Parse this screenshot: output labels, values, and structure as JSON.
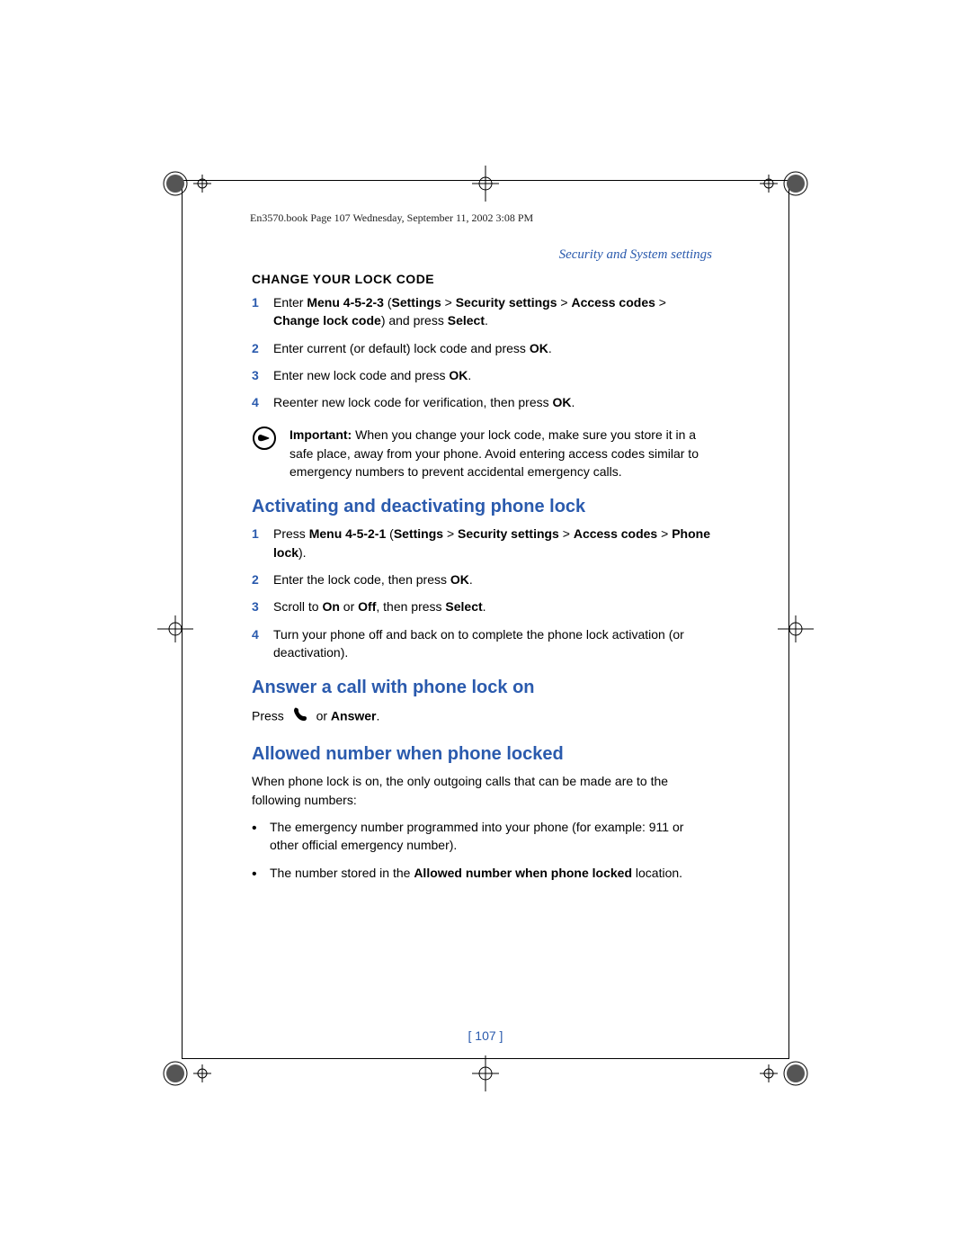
{
  "header_line": "En3570.book  Page 107  Wednesday, September 11, 2002  3:08 PM",
  "running_head": "Security and System settings",
  "section_change": {
    "title": "CHANGE YOUR LOCK CODE",
    "steps": [
      {
        "num": "1",
        "html": "Enter <b>Menu 4-5-2-3</b> (<b>Settings</b> > <b>Security settings</b> > <b>Access codes</b> > <b>Change lock code</b>) and press <b>Select</b>."
      },
      {
        "num": "2",
        "html": "Enter current (or default) lock code and press <b>OK</b>."
      },
      {
        "num": "3",
        "html": "Enter new lock code and press <b>OK</b>."
      },
      {
        "num": "4",
        "html": "Reenter new lock code for verification, then press <b>OK</b>."
      }
    ],
    "note_html": "<b>Important:</b> When you change your lock code, make sure you store it in a safe place, away from your phone. Avoid entering access codes similar to emergency numbers to prevent accidental emergency calls."
  },
  "section_activate": {
    "title": "Activating and deactivating phone lock",
    "steps": [
      {
        "num": "1",
        "html": "Press <b>Menu 4-5-2-1</b> (<b>Settings</b> > <b>Security settings</b> > <b>Access codes</b> > <b>Phone lock</b>)."
      },
      {
        "num": "2",
        "html": "Enter the lock code, then press <b>OK</b>."
      },
      {
        "num": "3",
        "html": "Scroll to <b>On</b> or <b>Off</b>, then press <b>Select</b>."
      },
      {
        "num": "4",
        "html": "Turn your phone off and back on to complete the phone lock activation (or deactivation)."
      }
    ]
  },
  "section_answer": {
    "title": "Answer a call with phone lock on",
    "press_before": "Press",
    "press_after": "or <b>Answer</b>."
  },
  "section_allowed": {
    "title": "Allowed number when phone locked",
    "intro": "When phone lock is on, the only outgoing calls that can be made are to the following numbers:",
    "bullets": [
      "The emergency number programmed into your phone (for example: 911 or other official emergency number).",
      "The number stored in the <b>Allowed number when phone locked</b> location."
    ]
  },
  "page_number": "[ 107 ]"
}
